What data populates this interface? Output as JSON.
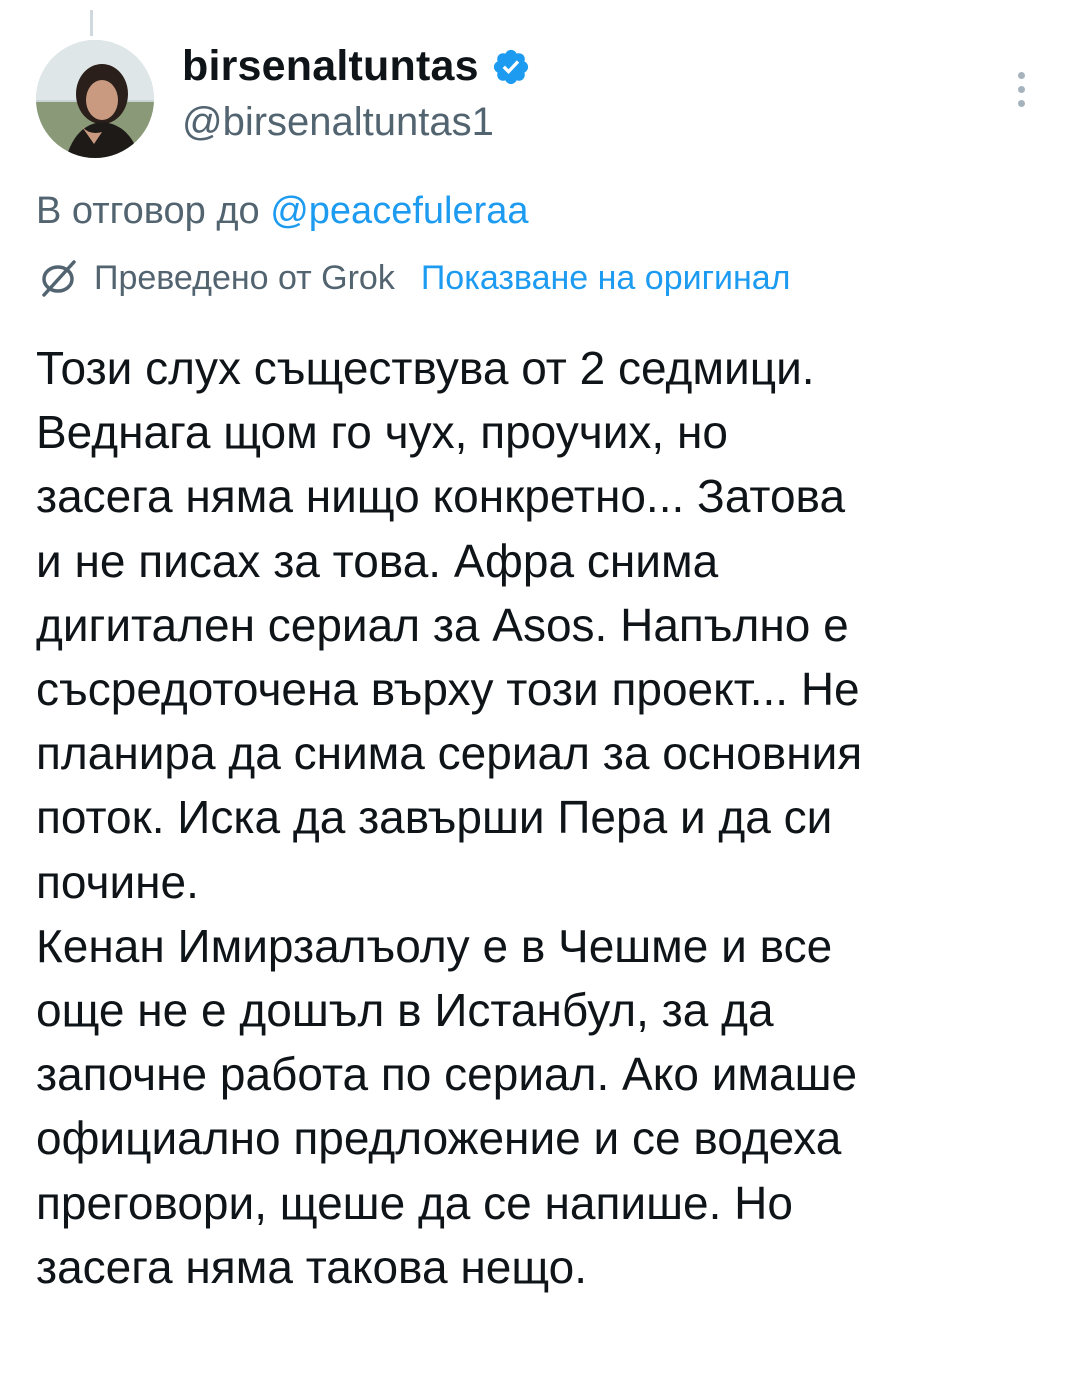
{
  "author": {
    "display_name": "birsenaltuntas",
    "handle": "@birsenaltuntas1",
    "verified": true
  },
  "reply": {
    "prefix": "В отговор до ",
    "mention": "@peacefuleraa"
  },
  "translation": {
    "label": "Преведено от Grok",
    "show_original": "Показване на оригинал"
  },
  "tweet": {
    "paragraphs": [
      "Този слух съществува от 2 седмици.\nВеднага щом го чух, проучих, но\nзасега няма нищо конкретно... Затова\nи не писах за това. Афра снима\nдигитален сериал за Asos. Напълно е\nсъсредоточена върху този проект... Не\nпланира да снима сериал за основния\nпоток. Иска да завърши Пера и да си\nпочине.",
      "Кенан Имирзалъолу е в Чешме и все\nоще не е дошъл в Истанбул, за да\nзапочне работа по сериал. Ако имаше\nофициално предложение и се водеха\nпреговори, щеше да се напише. Но\nзасега няма такова нещо."
    ]
  },
  "colors": {
    "text": "#0f1419",
    "secondary": "#536471",
    "link": "#1d9bf0",
    "verified_badge": "#1d9bf0"
  },
  "icons": [
    "verified-badge-icon",
    "more-icon",
    "translate-icon"
  ]
}
